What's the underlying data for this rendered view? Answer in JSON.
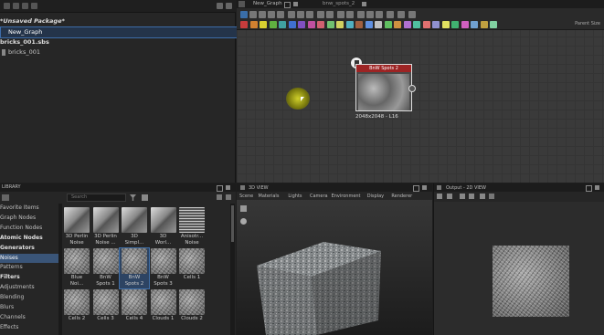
{
  "explorer": {
    "package": "*Unsaved Package*",
    "graph_item": "New_Graph",
    "sbs_file": "bricks_001.sbs",
    "sbs_item": "bricks_001"
  },
  "graph": {
    "tabs": [
      "New_Graph",
      "bnw_spots_2"
    ],
    "parent_size": "Parent Size",
    "node": {
      "title": "BnW Spots 2",
      "info": "2048x2048 - L16",
      "header_color": "#9d2424"
    },
    "toolbar_colors": [
      "#c83c3c",
      "#d08030",
      "#d8d030",
      "#60b040",
      "#40a0a0",
      "#4070d0",
      "#8050c0",
      "#c050a0",
      "#d06070",
      "#70c070",
      "#d0d060",
      "#50b0c0",
      "#a06040",
      "#6090e0",
      "#c0c0c0",
      "#60c060",
      "#d09040",
      "#b070d0",
      "#50c0a0",
      "#e07070",
      "#9090d0",
      "#e0e060",
      "#40b070",
      "#d060c0",
      "#70a0d0",
      "#c0a040",
      "#80d0a0"
    ]
  },
  "library": {
    "title": "LIBRARY",
    "search_placeholder": "Search",
    "categories": [
      {
        "label": "Favorite Items",
        "style": "normal"
      },
      {
        "label": "Graph Nodes",
        "style": "normal"
      },
      {
        "label": "Function Nodes",
        "style": "normal"
      },
      {
        "label": "Atomic Nodes",
        "style": "bold"
      },
      {
        "label": "Generators",
        "style": "bold"
      },
      {
        "label": "Noises",
        "style": "active"
      },
      {
        "label": "Patterns",
        "style": "normal"
      },
      {
        "label": "Filters",
        "style": "bold"
      },
      {
        "label": "Adjustments",
        "style": "normal"
      },
      {
        "label": "Blending",
        "style": "normal"
      },
      {
        "label": "Blurs",
        "style": "normal"
      },
      {
        "label": "Channels",
        "style": "normal"
      },
      {
        "label": "Effects",
        "style": "normal"
      }
    ],
    "tiles": [
      {
        "label1": "3D Perlin",
        "label2": "Noise"
      },
      {
        "label1": "3D Perlin",
        "label2": "Noise ..."
      },
      {
        "label1": "3D",
        "label2": "Simpl..."
      },
      {
        "label1": "3D",
        "label2": "Worl..."
      },
      {
        "label1": "Anisotr...",
        "label2": "Noise"
      },
      {
        "label1": "Blue",
        "label2": "Noi..."
      },
      {
        "label1": "BnW",
        "label2": "Spots 1"
      },
      {
        "label1": "BnW",
        "label2": "Spots 2"
      },
      {
        "label1": "BnW",
        "label2": "Spots 3"
      },
      {
        "label1": "Cells 1",
        "label2": ""
      },
      {
        "label1": "Cells 2",
        "label2": ""
      },
      {
        "label1": "Cells 3",
        "label2": ""
      },
      {
        "label1": "Cells 4",
        "label2": ""
      },
      {
        "label1": "Clouds 1",
        "label2": ""
      },
      {
        "label1": "Clouds 2",
        "label2": ""
      }
    ]
  },
  "view3d": {
    "title": "3D VIEW",
    "menu": [
      "Scene",
      "Materials",
      "Lights",
      "Camera",
      "Environment",
      "Display",
      "Renderer"
    ]
  },
  "view2d": {
    "title": "Output - 2D VIEW"
  }
}
